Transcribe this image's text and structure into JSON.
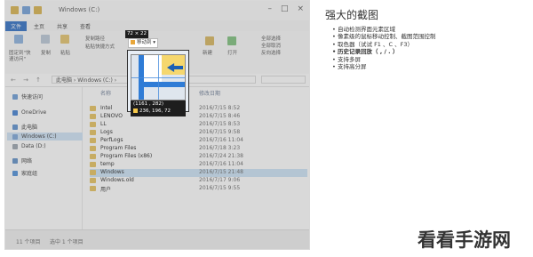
{
  "explorer": {
    "window_title": "Windows (C:)",
    "ribbon_tabs": [
      "文件",
      "主页",
      "共享",
      "查看"
    ],
    "ribbon_labels": [
      "固定到\"快速访问\"",
      "复制",
      "粘贴",
      "复制路径",
      "粘贴快捷方式",
      "新建",
      "打开",
      "全部选择",
      "全部取消",
      "反向选择"
    ],
    "address_path": "此电脑 › Windows (C:) ›",
    "sidebar": [
      "快速访问",
      "OneDrive",
      "此电脑",
      "Windows (C:)",
      "Data (D:)",
      "网络",
      "家庭组"
    ],
    "columns": {
      "name": "名称",
      "date": "修改日期"
    },
    "rows": [
      {
        "name": "Intel",
        "date": "2016/7/15 8:52"
      },
      {
        "name": "LENOVO",
        "date": "2016/7/15 8:46"
      },
      {
        "name": "LL",
        "date": "2016/7/15 8:53"
      },
      {
        "name": "Logs",
        "date": "2016/7/15 9:58"
      },
      {
        "name": "PerfLogs",
        "date": "2016/7/16 11:04"
      },
      {
        "name": "Program Files",
        "date": "2016/7/18 3:23"
      },
      {
        "name": "Program Files (x86)",
        "date": "2016/7/24 21:38"
      },
      {
        "name": "temp",
        "date": "2016/7/16 11:04"
      },
      {
        "name": "Windows",
        "date": "2016/7/15 21:48"
      },
      {
        "name": "Windows.old",
        "date": "2016/7/17 9:06"
      },
      {
        "name": "用户",
        "date": "2016/7/15 9:55"
      }
    ],
    "status": {
      "count": "11 个项目",
      "selected": "选中 1 个项目"
    }
  },
  "capture_overlay": {
    "size_label": "72 × 22",
    "button_label": "移动到 ▾",
    "coords": "(1161 , 282)",
    "rgb": "236, 196, 72"
  },
  "panel": {
    "heading": "强大的截图",
    "features": [
      {
        "text": "自动检测界面元素区域",
        "bold": false
      },
      {
        "text": "像素级的鼠标移动控制、截图范围控制",
        "bold": false
      },
      {
        "text": "取色器（试试 F1 、C 、F3）",
        "bold": false
      },
      {
        "text": "历史记录回放（ , / . ）",
        "bold": true
      },
      {
        "text": "支持多屏",
        "bold": false
      },
      {
        "text": "支持高分屏",
        "bold": false
      }
    ]
  },
  "watermark": "看看手游网",
  "colors": {
    "selection": "#cce4f7",
    "accent": "#2f7cd6",
    "key_red": "#d23c3c"
  }
}
